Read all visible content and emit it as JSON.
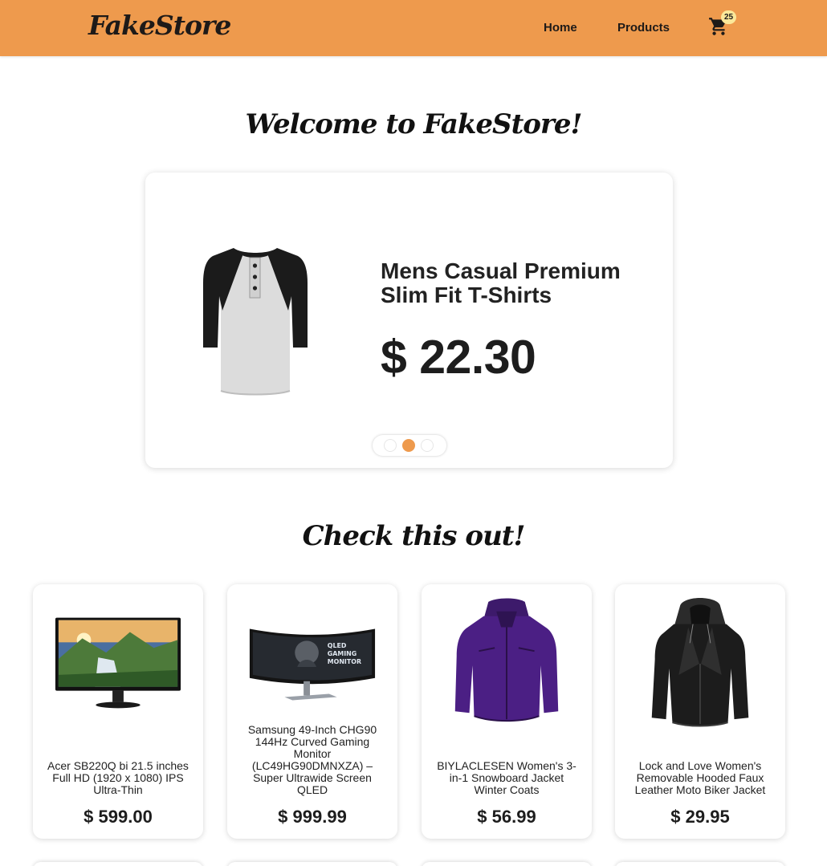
{
  "nav": {
    "logo": "FakeStore",
    "links": [
      "Home",
      "Products"
    ],
    "cart_count": "25",
    "cart_icon": "shopping-cart-icon"
  },
  "hero": {
    "heading": "Welcome to FakeStore!",
    "slide": {
      "title": "Mens Casual Premium Slim Fit T-Shirts",
      "price": "$ 22.30"
    },
    "active_slide": 2,
    "slide_count": 3
  },
  "featured": {
    "heading": "Check this out!",
    "products": [
      {
        "title": "Acer SB220Q bi 21.5 inches Full HD (1920 x 1080) IPS Ultra-Thin",
        "price": "$ 599.00"
      },
      {
        "title": "Samsung 49-Inch CHG90 144Hz Curved Gaming Monitor (LC49HG90DMNXZA) – Super Ultrawide Screen QLED",
        "price": "$ 999.99"
      },
      {
        "title": "BIYLACLESEN Women's 3-in-1 Snowboard Jacket Winter Coats",
        "price": "$ 56.99"
      },
      {
        "title": "Lock and Love Women's Removable Hooded Faux Leather Moto Biker Jacket",
        "price": "$ 29.95"
      }
    ]
  },
  "colors": {
    "accent": "#ee9a4d",
    "badge": "#fbe89a"
  }
}
